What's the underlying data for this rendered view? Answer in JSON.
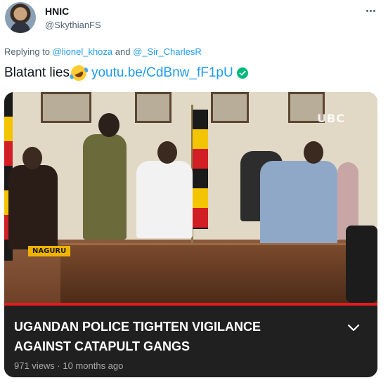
{
  "author": {
    "display_name": "HNIC",
    "handle": "@SkythianFS"
  },
  "reply": {
    "prefix": "Replying to ",
    "mention_1": "@lionel_khoza",
    "joiner": " and ",
    "mention_2": "@_Sir_CharlesR"
  },
  "tweet": {
    "text": "Blatant lies",
    "emoji_icon": "rolling-on-floor-laughing-emoji",
    "link_text": "youtu.be/CdBnw_fF1pU",
    "link_badge_icon": "verified-check-icon"
  },
  "card": {
    "title_line_1": "UGANDAN POLICE TIGHTEN VIGILANCE",
    "title_line_2": "AGAINST CATAPULT GANGS",
    "meta": "971 views · 10 months ago",
    "thumbnail_logo": "UBC",
    "location_tag": "NAGURU"
  },
  "colors": {
    "link": "#1d9bf0",
    "secondary_text": "#536471",
    "card_background": "#202020",
    "verified_badge": "#00ba7c",
    "progress": "#e31b1b"
  }
}
